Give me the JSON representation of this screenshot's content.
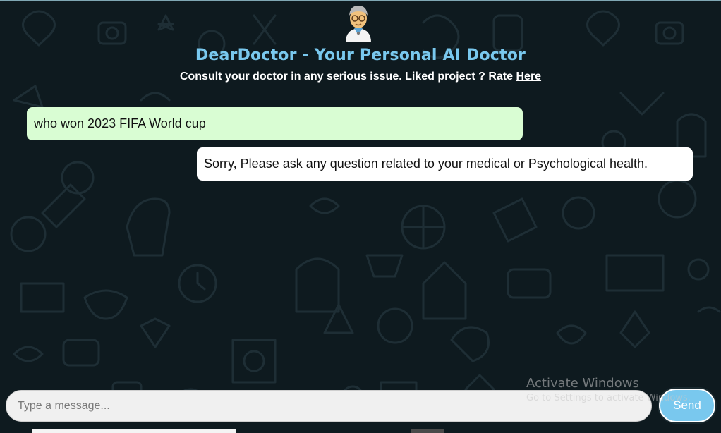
{
  "app": {
    "title": "DearDoctor - Your Personal AI Doctor",
    "subtitle_text": "Consult your doctor in any serious issue. Liked project ? Rate ",
    "subtitle_link": "Here",
    "avatar_icon": "doctor-avatar-icon"
  },
  "messages": [
    {
      "role": "user",
      "text": "who won 2023 FIFA World cup"
    },
    {
      "role": "bot",
      "text": "Sorry, Please ask any question related to your medical or Psychological health."
    }
  ],
  "composer": {
    "placeholder": "Type a message...",
    "value": "",
    "send_label": "Send"
  },
  "watermark": {
    "title": "Activate Windows",
    "subtitle": "Go to Settings to activate Windows."
  },
  "colors": {
    "accent": "#79c8ee",
    "background": "#0e1a1f",
    "user_bubble": "#d9fdd3",
    "bot_bubble": "#ffffff"
  }
}
